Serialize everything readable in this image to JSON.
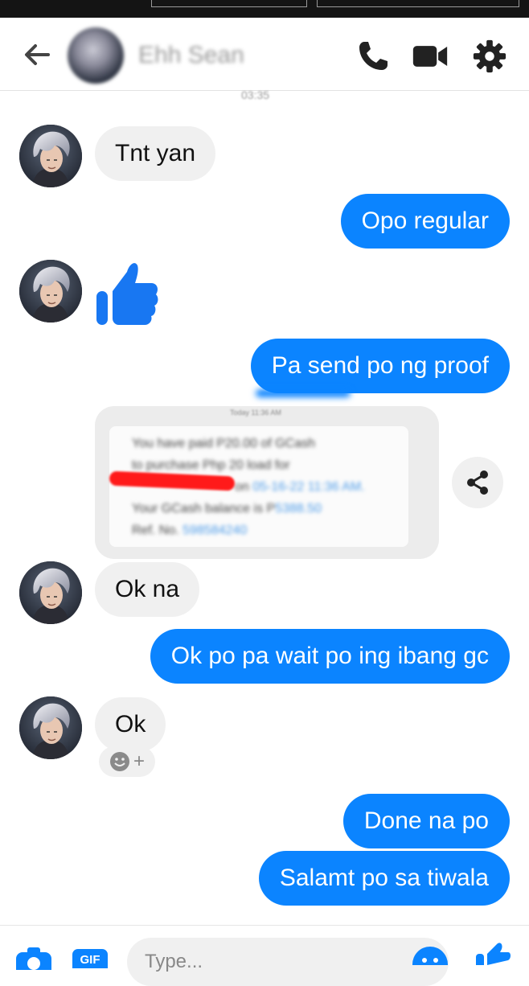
{
  "header": {
    "contact_name": "Ehh Sean",
    "timestamp": "03:35",
    "icons": [
      "back-arrow-icon",
      "phone-icon",
      "video-camera-icon",
      "gear-icon"
    ]
  },
  "messages": {
    "m1": "Tnt yan",
    "m2": "Opo regular",
    "m3": "Pa send po ng proof",
    "m4": "Ok na",
    "m5": "Ok po pa wait po ing ibang gc",
    "m6": "Ok",
    "m7": "Done na po",
    "m8": "Salamt po sa tiwala"
  },
  "proof_card": {
    "stamp": "Today 11:36 AM",
    "line1": "You have paid P20.00 of GCash",
    "line2": "to purchase Php 20 load for",
    "line3_pre": "on",
    "line3_link": "05-16-22 11:36 AM.",
    "line4": "Your GCash balance is P",
    "line4_link": "5388.50",
    "line5": "Ref. No.",
    "line5_link": "598584240"
  },
  "composer": {
    "placeholder": "Type..."
  },
  "colors": {
    "accent": "#0b84ff",
    "incoming_bubble": "#f0f0f0",
    "header_icons": "#222222"
  }
}
